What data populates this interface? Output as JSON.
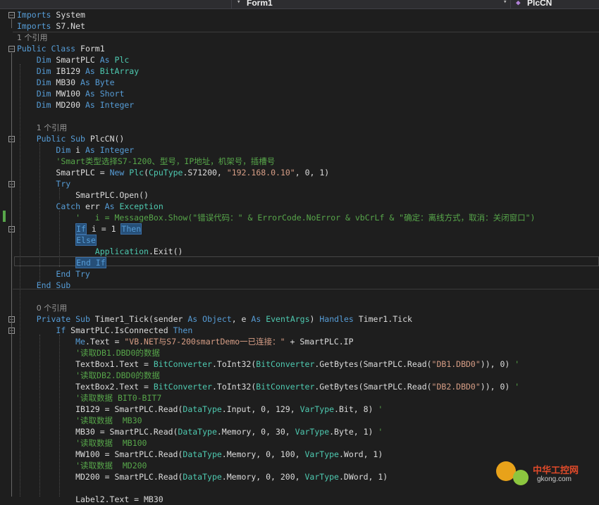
{
  "toolbar": {
    "class_dropdown": "Form1",
    "member_dropdown": "PlcCN"
  },
  "code_lines": [
    {
      "parts": [
        [
          "k",
          "Imports"
        ],
        [
          "p",
          " System"
        ]
      ]
    },
    {
      "parts": [
        [
          "k",
          "Imports"
        ],
        [
          "p",
          " S7.Net"
        ]
      ]
    },
    {
      "parts": [
        [
          "r",
          "1 个引用"
        ]
      ]
    },
    {
      "parts": [
        [
          "k",
          "Public Class"
        ],
        [
          "p",
          " Form1"
        ]
      ]
    },
    {
      "parts": [
        [
          "p",
          "    "
        ],
        [
          "k",
          "Dim"
        ],
        [
          "p",
          " SmartPLC "
        ],
        [
          "k",
          "As"
        ],
        [
          "p",
          " "
        ],
        [
          "t",
          "Plc"
        ]
      ]
    },
    {
      "parts": [
        [
          "p",
          "    "
        ],
        [
          "k",
          "Dim"
        ],
        [
          "p",
          " IB129 "
        ],
        [
          "k",
          "As"
        ],
        [
          "p",
          " "
        ],
        [
          "t",
          "BitArray"
        ]
      ]
    },
    {
      "parts": [
        [
          "p",
          "    "
        ],
        [
          "k",
          "Dim"
        ],
        [
          "p",
          " MB30 "
        ],
        [
          "k",
          "As"
        ],
        [
          "p",
          " "
        ],
        [
          "k",
          "Byte"
        ]
      ]
    },
    {
      "parts": [
        [
          "p",
          "    "
        ],
        [
          "k",
          "Dim"
        ],
        [
          "p",
          " MW100 "
        ],
        [
          "k",
          "As"
        ],
        [
          "p",
          " "
        ],
        [
          "k",
          "Short"
        ]
      ]
    },
    {
      "parts": [
        [
          "p",
          "    "
        ],
        [
          "k",
          "Dim"
        ],
        [
          "p",
          " MD200 "
        ],
        [
          "k",
          "As"
        ],
        [
          "p",
          " "
        ],
        [
          "k",
          "Integer"
        ]
      ]
    },
    {
      "parts": [
        [
          "p",
          ""
        ]
      ]
    },
    {
      "parts": [
        [
          "p",
          "    "
        ],
        [
          "r",
          "1 个引用"
        ]
      ]
    },
    {
      "parts": [
        [
          "p",
          "    "
        ],
        [
          "k",
          "Public Sub"
        ],
        [
          "p",
          " PlcCN()"
        ]
      ]
    },
    {
      "parts": [
        [
          "p",
          "        "
        ],
        [
          "k",
          "Dim"
        ],
        [
          "p",
          " i "
        ],
        [
          "k",
          "As"
        ],
        [
          "p",
          " "
        ],
        [
          "k",
          "Integer"
        ]
      ]
    },
    {
      "parts": [
        [
          "p",
          "        "
        ],
        [
          "c",
          "'Smart类型选择S7-1200、型号，IP地址，机架号，插槽号"
        ]
      ]
    },
    {
      "parts": [
        [
          "p",
          "        SmartPLC = "
        ],
        [
          "k",
          "New"
        ],
        [
          "p",
          " "
        ],
        [
          "t",
          "Plc"
        ],
        [
          "p",
          "("
        ],
        [
          "t",
          "CpuType"
        ],
        [
          "p",
          ".S71200, "
        ],
        [
          "s",
          "\"192.168.0.10\""
        ],
        [
          "p",
          ", 0, 1)"
        ]
      ]
    },
    {
      "parts": [
        [
          "p",
          "        "
        ],
        [
          "k",
          "Try"
        ]
      ]
    },
    {
      "parts": [
        [
          "p",
          "            SmartPLC.Open()"
        ]
      ]
    },
    {
      "parts": [
        [
          "p",
          "        "
        ],
        [
          "k",
          "Catch"
        ],
        [
          "p",
          " err "
        ],
        [
          "k",
          "As"
        ],
        [
          "p",
          " "
        ],
        [
          "t",
          "Exception"
        ]
      ]
    },
    {
      "parts": [
        [
          "p",
          "            "
        ],
        [
          "c",
          "'   i = MessageBox.Show(\"错误代码：\" & ErrorCode.NoError & vbCrLf & \"确定：离线方式，取消：关闭窗口\")"
        ]
      ]
    },
    {
      "parts": [
        [
          "p",
          "            "
        ],
        [
          "kh",
          "If"
        ],
        [
          "p",
          " i = 1 "
        ],
        [
          "kh",
          "Then"
        ]
      ]
    },
    {
      "parts": [
        [
          "p",
          "            "
        ],
        [
          "kh",
          "Else"
        ]
      ]
    },
    {
      "parts": [
        [
          "p",
          "                "
        ],
        [
          "t",
          "Application"
        ],
        [
          "p",
          ".Exit()"
        ]
      ]
    },
    {
      "parts": [
        [
          "p",
          "            "
        ],
        [
          "kh",
          "End If"
        ]
      ]
    },
    {
      "parts": [
        [
          "p",
          "        "
        ],
        [
          "k",
          "End Try"
        ]
      ]
    },
    {
      "parts": [
        [
          "p",
          "    "
        ],
        [
          "k",
          "End Sub"
        ]
      ]
    },
    {
      "parts": [
        [
          "p",
          ""
        ]
      ]
    },
    {
      "parts": [
        [
          "p",
          "    "
        ],
        [
          "r",
          "0 个引用"
        ]
      ]
    },
    {
      "parts": [
        [
          "p",
          "    "
        ],
        [
          "k",
          "Private Sub"
        ],
        [
          "p",
          " Timer1_Tick(sender "
        ],
        [
          "k",
          "As"
        ],
        [
          "p",
          " "
        ],
        [
          "k",
          "Object"
        ],
        [
          "p",
          ", e "
        ],
        [
          "k",
          "As"
        ],
        [
          "p",
          " "
        ],
        [
          "t",
          "EventArgs"
        ],
        [
          "p",
          ") "
        ],
        [
          "k",
          "Handles"
        ],
        [
          "p",
          " Timer1.Tick"
        ]
      ]
    },
    {
      "parts": [
        [
          "p",
          "        "
        ],
        [
          "k",
          "If"
        ],
        [
          "p",
          " SmartPLC.IsConnected "
        ],
        [
          "k",
          "Then"
        ]
      ]
    },
    {
      "parts": [
        [
          "p",
          "            "
        ],
        [
          "k",
          "Me"
        ],
        [
          "p",
          ".Text = "
        ],
        [
          "s",
          "\"VB.NET与S7-200smartDemo一已连接：\""
        ],
        [
          "p",
          " + SmartPLC.IP"
        ]
      ]
    },
    {
      "parts": [
        [
          "p",
          "            "
        ],
        [
          "c",
          "'读取DB1.DBD0的数据"
        ]
      ]
    },
    {
      "parts": [
        [
          "p",
          "            TextBox1.Text = "
        ],
        [
          "t",
          "BitConverter"
        ],
        [
          "p",
          ".ToInt32("
        ],
        [
          "t",
          "BitConverter"
        ],
        [
          "p",
          ".GetBytes(SmartPLC.Read("
        ],
        [
          "s",
          "\"DB1.DBD0\""
        ],
        [
          "p",
          ")), 0) "
        ],
        [
          "c",
          "'"
        ]
      ]
    },
    {
      "parts": [
        [
          "p",
          "            "
        ],
        [
          "c",
          "'读取DB2.DBD0的数据"
        ]
      ]
    },
    {
      "parts": [
        [
          "p",
          "            TextBox2.Text = "
        ],
        [
          "t",
          "BitConverter"
        ],
        [
          "p",
          ".ToInt32("
        ],
        [
          "t",
          "BitConverter"
        ],
        [
          "p",
          ".GetBytes(SmartPLC.Read("
        ],
        [
          "s",
          "\"DB2.DBD0\""
        ],
        [
          "p",
          ")), 0) "
        ],
        [
          "c",
          "'"
        ]
      ]
    },
    {
      "parts": [
        [
          "p",
          "            "
        ],
        [
          "c",
          "'读取数据 BIT0-BIT7"
        ]
      ]
    },
    {
      "parts": [
        [
          "p",
          "            IB129 = SmartPLC.Read("
        ],
        [
          "t",
          "DataType"
        ],
        [
          "p",
          ".Input, 0, 129, "
        ],
        [
          "t",
          "VarType"
        ],
        [
          "p",
          ".Bit, 8) "
        ],
        [
          "c",
          "'"
        ]
      ]
    },
    {
      "parts": [
        [
          "p",
          "            "
        ],
        [
          "c",
          "'读取数据  MB30"
        ]
      ]
    },
    {
      "parts": [
        [
          "p",
          "            MB30 = SmartPLC.Read("
        ],
        [
          "t",
          "DataType"
        ],
        [
          "p",
          ".Memory, 0, 30, "
        ],
        [
          "t",
          "VarType"
        ],
        [
          "p",
          ".Byte, 1) "
        ],
        [
          "c",
          "'"
        ]
      ]
    },
    {
      "parts": [
        [
          "p",
          "            "
        ],
        [
          "c",
          "'读取数据  MB100"
        ]
      ]
    },
    {
      "parts": [
        [
          "p",
          "            MW100 = SmartPLC.Read("
        ],
        [
          "t",
          "DataType"
        ],
        [
          "p",
          ".Memory, 0, 100, "
        ],
        [
          "t",
          "VarType"
        ],
        [
          "p",
          ".Word, 1)"
        ]
      ]
    },
    {
      "parts": [
        [
          "p",
          "            "
        ],
        [
          "c",
          "'读取数据  MD200"
        ]
      ]
    },
    {
      "parts": [
        [
          "p",
          "            MD200 = SmartPLC.Read("
        ],
        [
          "t",
          "DataType"
        ],
        [
          "p",
          ".Memory, 0, 200, "
        ],
        [
          "t",
          "VarType"
        ],
        [
          "p",
          ".DWord, 1)"
        ]
      ]
    },
    {
      "parts": [
        [
          "p",
          ""
        ]
      ]
    },
    {
      "parts": [
        [
          "p",
          "            Label2.Text = MB30"
        ]
      ]
    }
  ],
  "watermark": {
    "title": "中华工控网",
    "url": "gkong.com"
  },
  "colors": {
    "keyword": "#569cd6",
    "type": "#4ec9b0",
    "string": "#d69d85",
    "comment": "#57a64a",
    "background": "#1e1e1e"
  }
}
